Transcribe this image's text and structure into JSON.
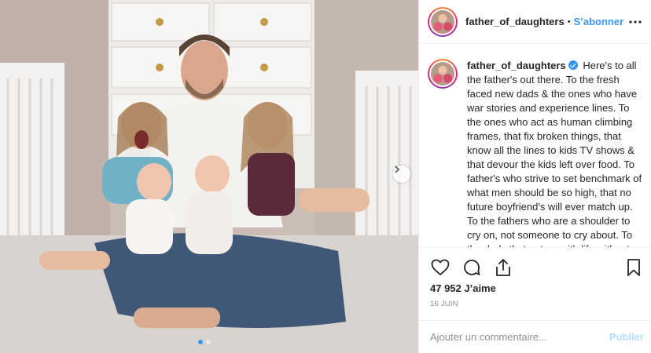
{
  "post": {
    "username": "father_of_daughters",
    "separator": "•",
    "follow_label": "S’abonner",
    "more_icon": "more-horizontal-icon",
    "caption_user": "father_of_daughters",
    "caption_text": "Here's to all the father's out there. To the fresh faced new dads & the ones who have war stories and experience lines. To the ones who act as human climbing frames, that fix broken things, that know all the lines to kids TV shows & that devour the kids left over food. To father's who strive to set benchmark of what men should be so high, that no future boyfriend's will ever match up. To the fathers who are a shoulder to cry on, not someone to cry about. To the dads that get on with life without making a drama, that stand in the",
    "likes_text": "47 952 J’aime",
    "date_text": "16 JUIN",
    "comment_placeholder": "Ajouter un commentaire...",
    "publish_label": "Publier",
    "carousel": {
      "total": 2,
      "active": 0
    }
  },
  "colors": {
    "accent": "#3897f0",
    "publish_disabled": "#b2dffc",
    "muted": "#8e8e8e",
    "text": "#262626"
  }
}
